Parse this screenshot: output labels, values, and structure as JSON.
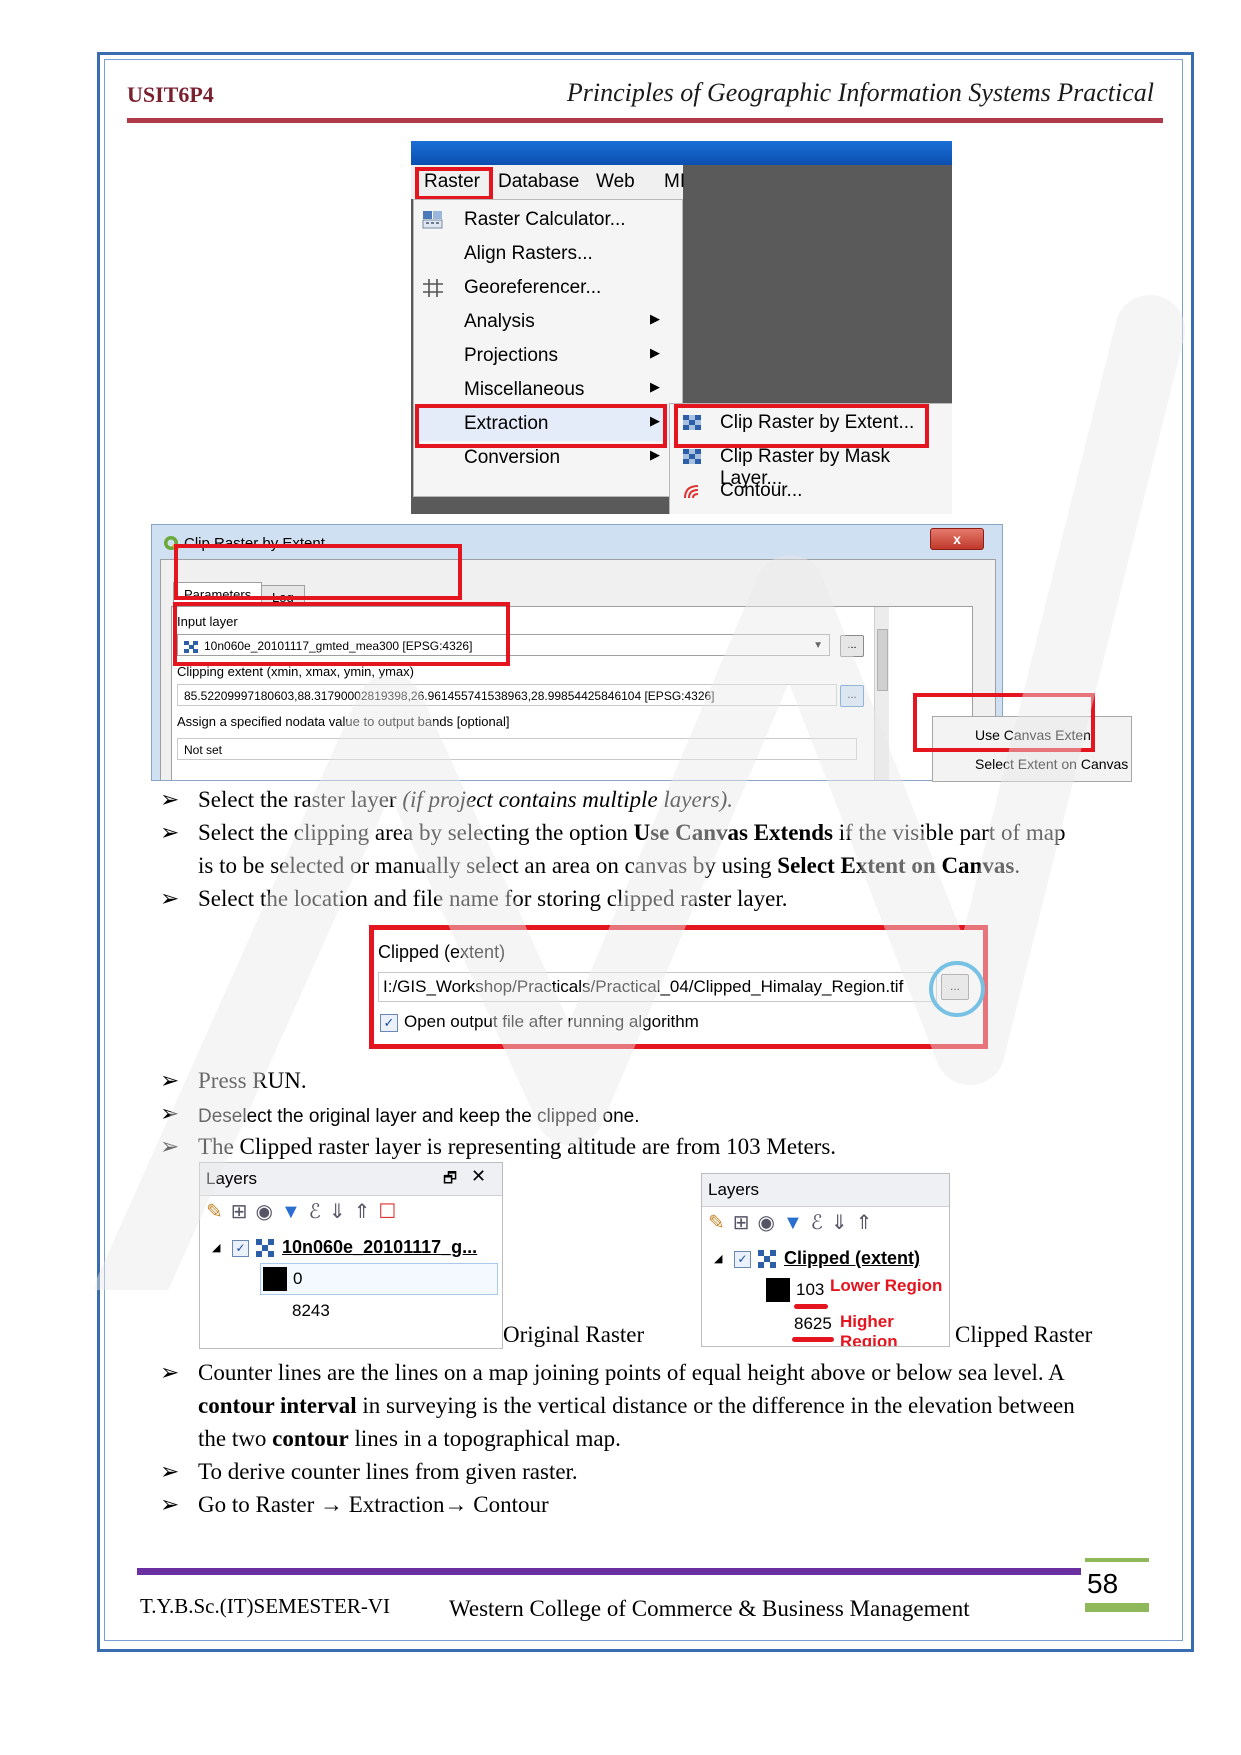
{
  "header": {
    "course_code": "USIT6P4",
    "subject": "Principles of Geographic Information Systems Practical"
  },
  "menu_shot": {
    "menubar": [
      "Raster",
      "Database",
      "Web",
      "MI"
    ],
    "items": [
      {
        "label": "Raster Calculator...",
        "icon": "raster-calculator-icon",
        "submenu": false
      },
      {
        "label": "Align Rasters...",
        "icon": "",
        "submenu": false
      },
      {
        "label": "Georeferencer...",
        "icon": "georeferencer-grid-icon",
        "submenu": false
      },
      {
        "label": "Analysis",
        "icon": "",
        "submenu": true
      },
      {
        "label": "Projections",
        "icon": "",
        "submenu": true
      },
      {
        "label": "Miscellaneous",
        "icon": "",
        "submenu": true
      },
      {
        "label": "Extraction",
        "icon": "",
        "submenu": true
      },
      {
        "label": "Conversion",
        "icon": "",
        "submenu": true
      }
    ],
    "submenu_items": [
      "Clip Raster by Extent...",
      "Clip Raster by Mask Layer...",
      "Contour..."
    ],
    "arrow": "▶"
  },
  "dialog": {
    "title": "Clip Raster by Extent",
    "close": "x",
    "tabs": [
      "Parameters",
      "Log"
    ],
    "input_layer_label": "Input layer",
    "input_layer_value": "10n060e_20101117_gmted_mea300 [EPSG:4326]",
    "clip_extent_label": "Clipping extent (xmin, xmax, ymin, ymax)",
    "clip_extent_value": "85.52209997180603,88.31790002819398,26.961455741538963,28.99854425846104 [EPSG:4326]",
    "nodata_label": "Assign a specified nodata value to output bands [optional]",
    "nodata_value": "Not set",
    "dots": "...",
    "popup_items": [
      "Use Canvas Extent",
      "Select Extent on Canvas"
    ]
  },
  "bullets_a": [
    {
      "plain": "Select the raster layer ",
      "italic": "(if project contains multiple layers)."
    },
    {
      "p1": "Select the clipping area by selecting the option ",
      "b1": "Use Canvas Extends",
      "p2": " if the visible part of map",
      "p3": "is to be selected or manually select an area on canvas by using ",
      "b2": "Select Extent on Canvas",
      "p4": "."
    },
    {
      "plain": "Select the location and file name for storing clipped raster layer."
    }
  ],
  "clipped_field": {
    "label": "Clipped (extent)",
    "path": "I:/GIS_Workshop/Practicals/Practical_04/Clipped_Himalay_Region.tif",
    "button": "...",
    "checkbox_label": "Open output file after running algorithm",
    "check": "✓"
  },
  "bullets_b": [
    "Press RUN.",
    "Deselect the original layer and keep the clipped one.",
    "The Clipped raster layer is representing altitude are from 103 Meters."
  ],
  "layers_left": {
    "title": "Layers",
    "layer_name": "10n060e_20101117_g...",
    "min": "0",
    "max": "8243",
    "caption": "Original Raster"
  },
  "layers_right": {
    "title": "Layers",
    "layer_name": "Clipped (extent)",
    "min": "103",
    "max": "8625",
    "min_note": "Lower Region",
    "max_note": "Higher Region",
    "caption": "Clipped Raster"
  },
  "bullets_c": {
    "contour_p1": "Counter lines are the lines on a map joining points of equal height above or below sea level. A",
    "contour_b1": "contour interval",
    "contour_p2": " in surveying is the vertical distance or the difference in the elevation between",
    "contour_p3": "the two ",
    "contour_b2": "contour",
    "contour_p4": " lines in a topographical map.",
    "derive": "To derive counter lines from given raster.",
    "goto": "Go to Raster → Extraction→ Contour"
  },
  "bullet_marker": "➢",
  "footer": {
    "semester": "T.Y.B.Sc.(IT)SEMESTER-VI",
    "college": "Western College of Commerce & Business Management",
    "page": "58"
  },
  "colors": {
    "frame": "#3a6db0",
    "header_rule": "#b13a4a",
    "highlight_red": "#e4151f",
    "highlight_blue": "#1aa0e0",
    "footer_rule": "#6a2fa0",
    "page_green": "#8fb85a"
  }
}
